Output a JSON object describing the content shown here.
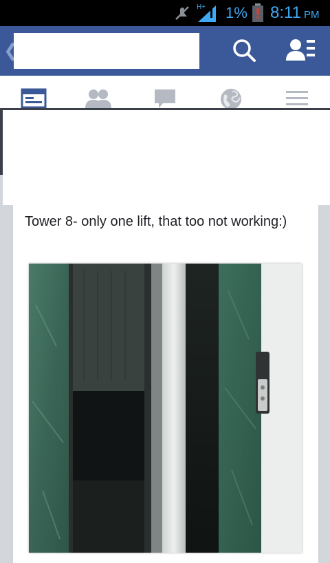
{
  "status_bar": {
    "network_label": "H+",
    "battery_percent": "1%",
    "time": "8:11",
    "ampm": "PM",
    "icons": [
      "mute-icon",
      "signal-icon",
      "battery-low-icon"
    ]
  },
  "app_bar": {
    "search": {
      "value": "",
      "placeholder": ""
    },
    "back_glyph": "❮",
    "icons": [
      "search-icon",
      "friends-icon"
    ],
    "color": "#3b5998"
  },
  "tabs": [
    {
      "id": "news-feed",
      "icon": "news-feed-icon",
      "active": true
    },
    {
      "id": "friend-requests",
      "icon": "friends-requests-icon",
      "active": false
    },
    {
      "id": "messages",
      "icon": "messages-icon",
      "active": false
    },
    {
      "id": "notifications",
      "icon": "globe-icon",
      "active": false
    },
    {
      "id": "more",
      "icon": "menu-icon",
      "active": false
    }
  ],
  "post": {
    "text": "Tower 8- only one lift,  that too not working:)",
    "photo": "elevator-photo"
  }
}
